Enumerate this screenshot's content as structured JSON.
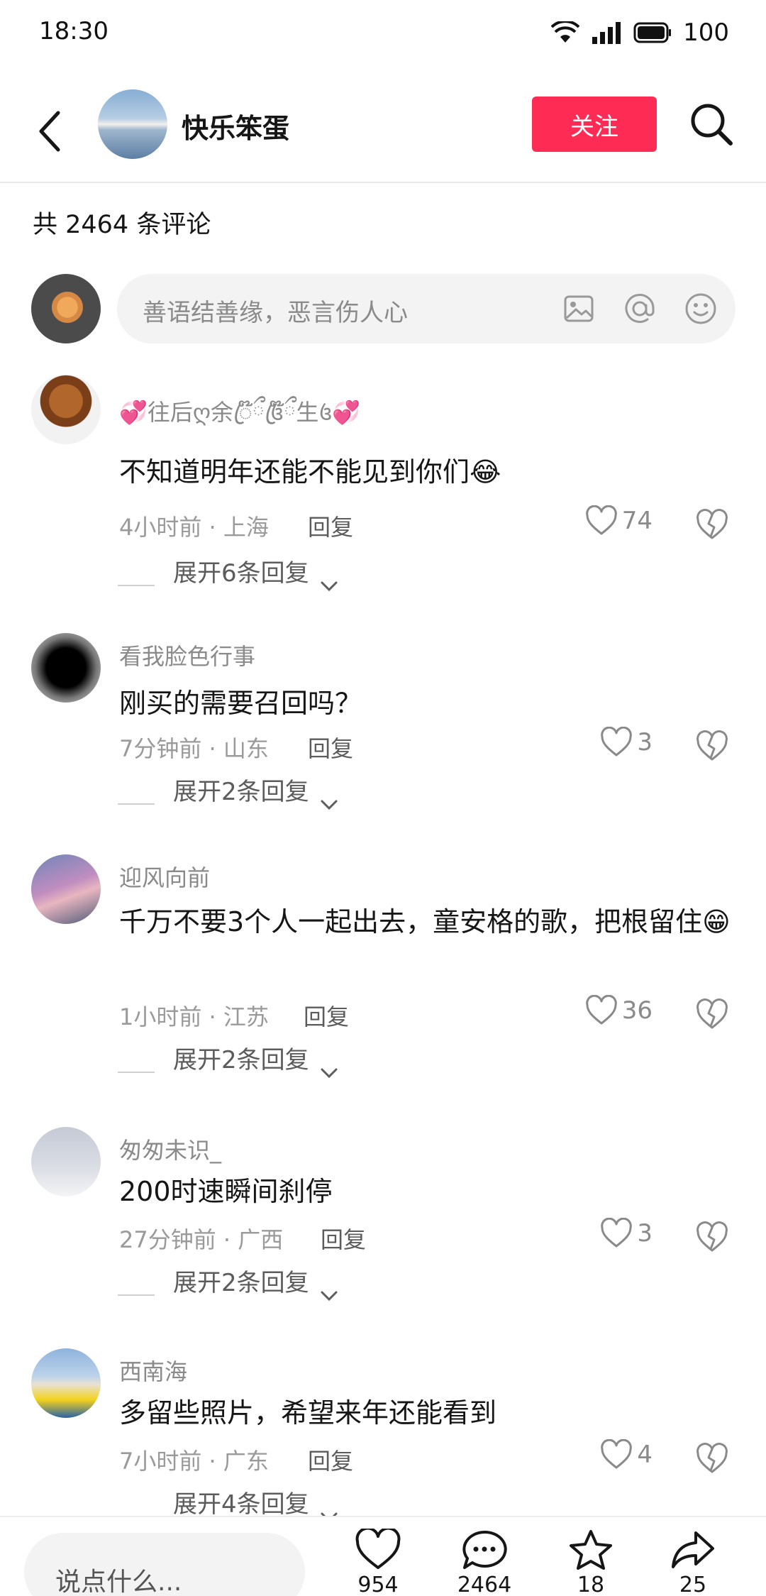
{
  "status_bar": {
    "time": "18:30",
    "battery": "100"
  },
  "header": {
    "user_name": "快乐笨蛋",
    "follow_label": "关注"
  },
  "comment_count_label": "共 2464 条评论",
  "input": {
    "placeholder": "善语结善缘，恶言伤人心"
  },
  "comments": [
    {
      "user": "💞往后ღ余ꦿ໊ྀ꧔ꦿ໊ྀ生꧔💞",
      "text": "不知道明年还能不能见到你们😂",
      "meta": "4小时前 · 上海",
      "reply_label": "回复",
      "likes": "74",
      "expand": "展开6条回复"
    },
    {
      "user": "看我脸色行事",
      "text": "刚买的需要召回吗？",
      "meta": "7分钟前 · 山东",
      "reply_label": "回复",
      "likes": "3",
      "expand": "展开2条回复"
    },
    {
      "user": "迎风向前",
      "text": "千万不要3个人一起出去，童安格的歌，把根留住😁",
      "meta": "1小时前 · 江苏",
      "reply_label": "回复",
      "likes": "36",
      "expand": "展开2条回复"
    },
    {
      "user": "匆匆未识_",
      "text": "200时速瞬间刹停",
      "meta": "27分钟前 · 广西",
      "reply_label": "回复",
      "likes": "3",
      "expand": "展开2条回复"
    },
    {
      "user": "西南海",
      "text": "多留些照片，希望来年还能看到",
      "meta": "7小时前 · 广东",
      "reply_label": "回复",
      "likes": "4",
      "expand": "展开4条回复"
    }
  ],
  "bottom_bar": {
    "input_placeholder": "说点什么...",
    "like_count": "954",
    "comment_count": "2464",
    "favorite_count": "18",
    "share_count": "25"
  },
  "colors": {
    "accent": "#fe2c55",
    "muted_text": "#8a8a8a"
  }
}
